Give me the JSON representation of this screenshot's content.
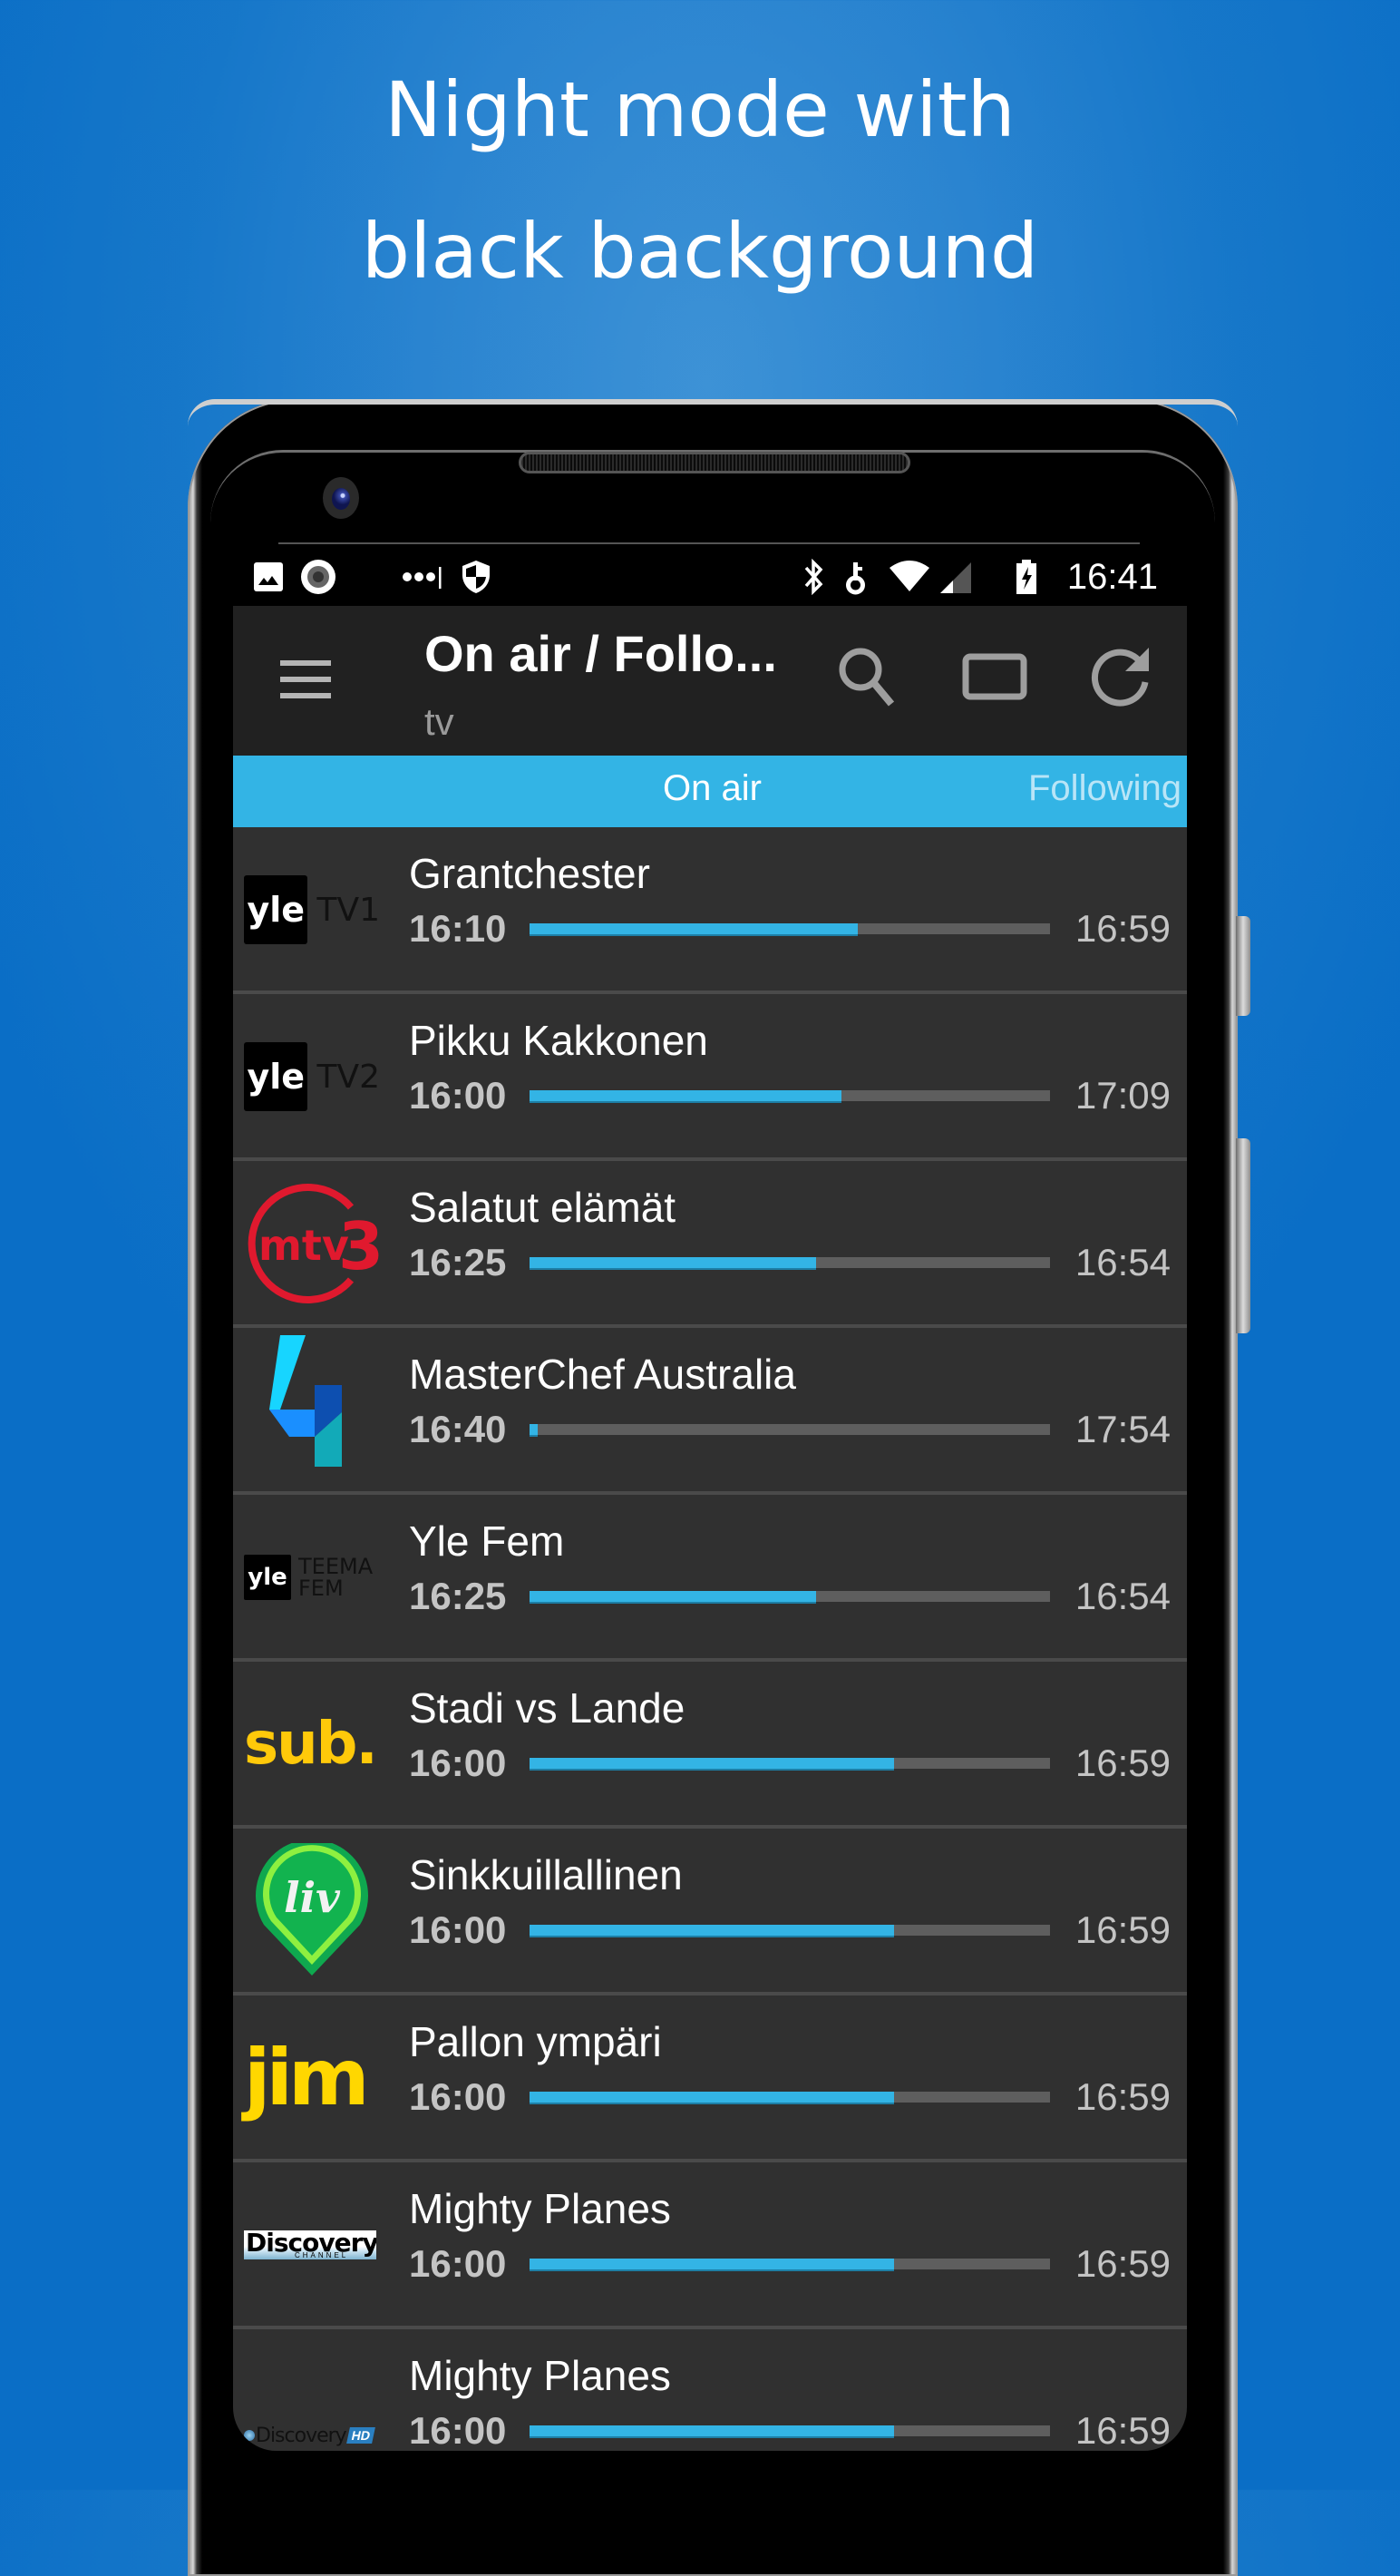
{
  "headline": {
    "line1": "Night mode with",
    "line2": "black background"
  },
  "status_bar": {
    "time": "16:41",
    "left_icons": [
      "gallery-icon",
      "record-icon",
      "signal-dots-icon",
      "shield-icon"
    ],
    "right_icons": [
      "bluetooth-icon",
      "key-icon",
      "wifi-icon",
      "cell-signal-icon",
      "battery-charging-icon"
    ]
  },
  "app_bar": {
    "title": "On air / Follo...",
    "subtitle": "tv",
    "actions": [
      "search-icon",
      "cast-window-icon",
      "refresh-icon"
    ]
  },
  "tabs": [
    {
      "label": "On air",
      "active": true
    },
    {
      "label": "Following",
      "active": false
    }
  ],
  "colors": {
    "accent": "#33b4e5",
    "row_bg": "#303030",
    "appbar_bg": "#212121"
  },
  "programs": [
    {
      "channel": "Yle TV1",
      "logo": {
        "type": "yle",
        "mark": "yle",
        "suffix": "TV1"
      },
      "title": "Grantchester",
      "start": "16:10",
      "end": "16:59",
      "progress": 0.63
    },
    {
      "channel": "Yle TV2",
      "logo": {
        "type": "yle",
        "mark": "yle",
        "suffix": "TV2"
      },
      "title": "Pikku Kakkonen",
      "start": "16:00",
      "end": "17:09",
      "progress": 0.6
    },
    {
      "channel": "MTV3",
      "logo": {
        "type": "mtv3",
        "mark": "mtv3"
      },
      "title": "Salatut elämät",
      "start": "16:25",
      "end": "16:54",
      "progress": 0.55
    },
    {
      "channel": "Nelonen",
      "logo": {
        "type": "four",
        "mark": "4"
      },
      "title": "MasterChef Australia",
      "start": "16:40",
      "end": "17:54",
      "progress": 0.015
    },
    {
      "channel": "Yle Teema Fem",
      "logo": {
        "type": "yle-teema",
        "mark": "yle",
        "suffix": "TEEMA",
        "suffix2": "FEM"
      },
      "title": "Yle Fem",
      "start": "16:25",
      "end": "16:54",
      "progress": 0.55
    },
    {
      "channel": "Sub",
      "logo": {
        "type": "sub",
        "mark": "sub."
      },
      "title": "Stadi vs Lande",
      "start": "16:00",
      "end": "16:59",
      "progress": 0.7
    },
    {
      "channel": "Liv",
      "logo": {
        "type": "liv",
        "mark": "liv"
      },
      "title": "Sinkkuillallinen",
      "start": "16:00",
      "end": "16:59",
      "progress": 0.7
    },
    {
      "channel": "Jim",
      "logo": {
        "type": "jim",
        "mark": "jim"
      },
      "title": "Pallon ympäri",
      "start": "16:00",
      "end": "16:59",
      "progress": 0.7
    },
    {
      "channel": "Discovery Channel",
      "logo": {
        "type": "discovery",
        "mark": "Discovery",
        "sub": "CHANNEL"
      },
      "title": "Mighty Planes",
      "start": "16:00",
      "end": "16:59",
      "progress": 0.7
    },
    {
      "channel": "Discovery HD",
      "logo": {
        "type": "discovery-hd",
        "mark": "Discovery",
        "badge": "HD"
      },
      "title": "Mighty Planes",
      "start": "16:00",
      "end": "16:59",
      "progress": 0.7
    }
  ]
}
